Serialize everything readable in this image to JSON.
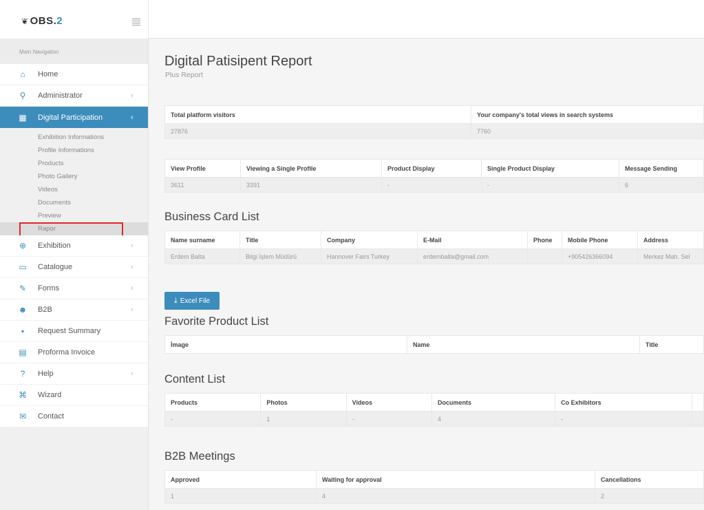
{
  "brand": {
    "logo_mark": "❦",
    "logo_text": "OBS.",
    "logo_num": "2"
  },
  "sidebar": {
    "header": "Main Navigation",
    "items": [
      {
        "label": "Home",
        "icon": "⌂",
        "icon_name": "home-icon"
      },
      {
        "label": "Administrator",
        "icon": "⚲",
        "icon_name": "key-icon",
        "chevron": "‹"
      },
      {
        "label": "Digital Participation",
        "icon": "▦",
        "icon_name": "dashboard-icon",
        "chevron": "‹",
        "active": true
      }
    ],
    "subitems": [
      "Exhibition Informations",
      "Profile Informations",
      "Products",
      "Photo Gallery",
      "Videos",
      "Documents",
      "Preview",
      "Rapor"
    ],
    "items_after": [
      {
        "label": "Exhibition",
        "icon": "⊕",
        "icon_name": "globe-icon",
        "chevron": "‹"
      },
      {
        "label": "Catalogue",
        "icon": "▭",
        "icon_name": "book-icon",
        "chevron": "‹"
      },
      {
        "label": "Forms",
        "icon": "✎",
        "icon_name": "edit-icon",
        "chevron": "‹"
      },
      {
        "label": "B2B",
        "icon": "☻",
        "icon_name": "users-icon",
        "chevron": "‹"
      },
      {
        "label": "Request Summary",
        "icon": "▪",
        "icon_name": "list-icon"
      },
      {
        "label": "Proforma Invoice",
        "icon": "▤",
        "icon_name": "invoice-icon"
      },
      {
        "label": "Help",
        "icon": "?",
        "icon_name": "help-icon",
        "chevron": "‹"
      },
      {
        "label": "Wizard",
        "icon": "⌘",
        "icon_name": "wizard-icon"
      },
      {
        "label": "Contact",
        "icon": "✉",
        "icon_name": "mail-icon"
      }
    ]
  },
  "main": {
    "title": "Digital Patisipent Report",
    "subtitle": "Plus Report",
    "visitors": {
      "headers": [
        "Total platform visitors",
        "Your company's total views in search systems"
      ],
      "row": [
        "27876",
        "7760"
      ]
    },
    "views": {
      "headers": [
        "View Profile",
        "Viewing a Single Profile",
        "Product Display",
        "Single Product Display",
        "Message Sending"
      ],
      "row": [
        "3611",
        "3391",
        "-",
        "-",
        "6"
      ]
    },
    "business_cards": {
      "title": "Business Card List",
      "headers": [
        "Name surname",
        "Title",
        "Company",
        "E-Mail",
        "Phone",
        "Mobile Phone",
        "Address"
      ],
      "row": [
        "Erdem Balta",
        "Bilgi İşlem Müdürü",
        "Hannover Fairs Turkey",
        "erdembalta@gmail.com",
        "",
        "+905426366094",
        "Merkez Mah. Sel"
      ]
    },
    "excel_button": {
      "label": "Excel File",
      "icon": "⤓"
    },
    "favorite_products": {
      "title": "Favorite Product List",
      "headers": [
        "İmage",
        "Name",
        "Title"
      ]
    },
    "content": {
      "title": "Content List",
      "headers": [
        "Products",
        "Photos",
        "Videos",
        "Documents",
        "Co Exhibitors",
        ""
      ],
      "row": [
        "-",
        "1",
        "-",
        "4",
        "-",
        ""
      ]
    },
    "b2b": {
      "title": "B2B Meetings",
      "headers": [
        "Approved",
        "Waiting for approval",
        "Cancellations"
      ],
      "row": [
        "1",
        "4",
        "2"
      ]
    }
  },
  "colors": {
    "accent": "#3c8dbc",
    "highlight": "#e0262c"
  }
}
